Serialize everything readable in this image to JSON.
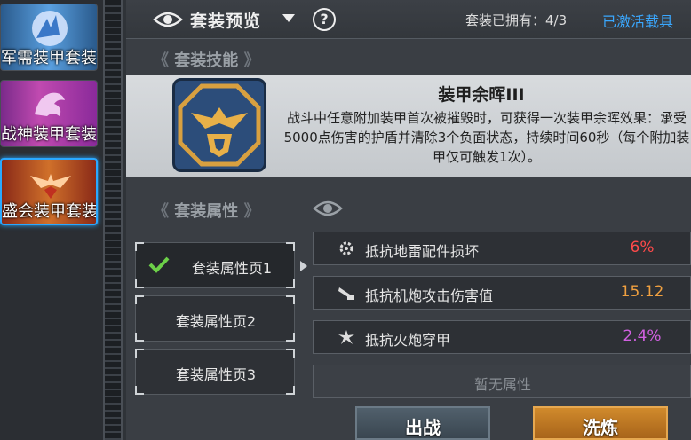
{
  "suit_list": [
    {
      "label": "军需装甲套装",
      "color": "#4a8ad0"
    },
    {
      "label": "战神装甲套装",
      "color": "#b04aa8"
    },
    {
      "label": "盛会装甲套装",
      "color": "#d0702a",
      "selected": true
    }
  ],
  "header": {
    "title": "套装预览",
    "help": "?",
    "owned": "套装已拥有：4/3",
    "activated_link": "已激活载具"
  },
  "skill": {
    "section_title": "套装技能",
    "name": "装甲余晖III",
    "description": "战斗中任意附加装甲首次被摧毁时，可获得一次装甲余晖效果：承受5000点伤害的护盾并清除3个负面状态，持续时间60秒（每个附加装甲仅可触发1次）。"
  },
  "attributes": {
    "section_title": "套装属性",
    "tabs": [
      {
        "label": "套装属性页1",
        "selected": true
      },
      {
        "label": "套装属性页2"
      },
      {
        "label": "套装属性页3"
      }
    ],
    "rows": [
      {
        "icon": "gear-icon",
        "name": "抵抗地雷配件损坏",
        "value": "6%",
        "color": "#ff4a4a"
      },
      {
        "icon": "cannon-icon",
        "name": "抵抗机炮攻击伤害值",
        "value": "15.12",
        "color": "#f0a040"
      },
      {
        "icon": "burst-icon",
        "name": "抵抗火炮穿甲",
        "value": "2.4%",
        "color": "#d060e0"
      }
    ],
    "empty_label": "暂无属性"
  },
  "buttons": {
    "battle": "出战",
    "refine": "洗炼"
  }
}
